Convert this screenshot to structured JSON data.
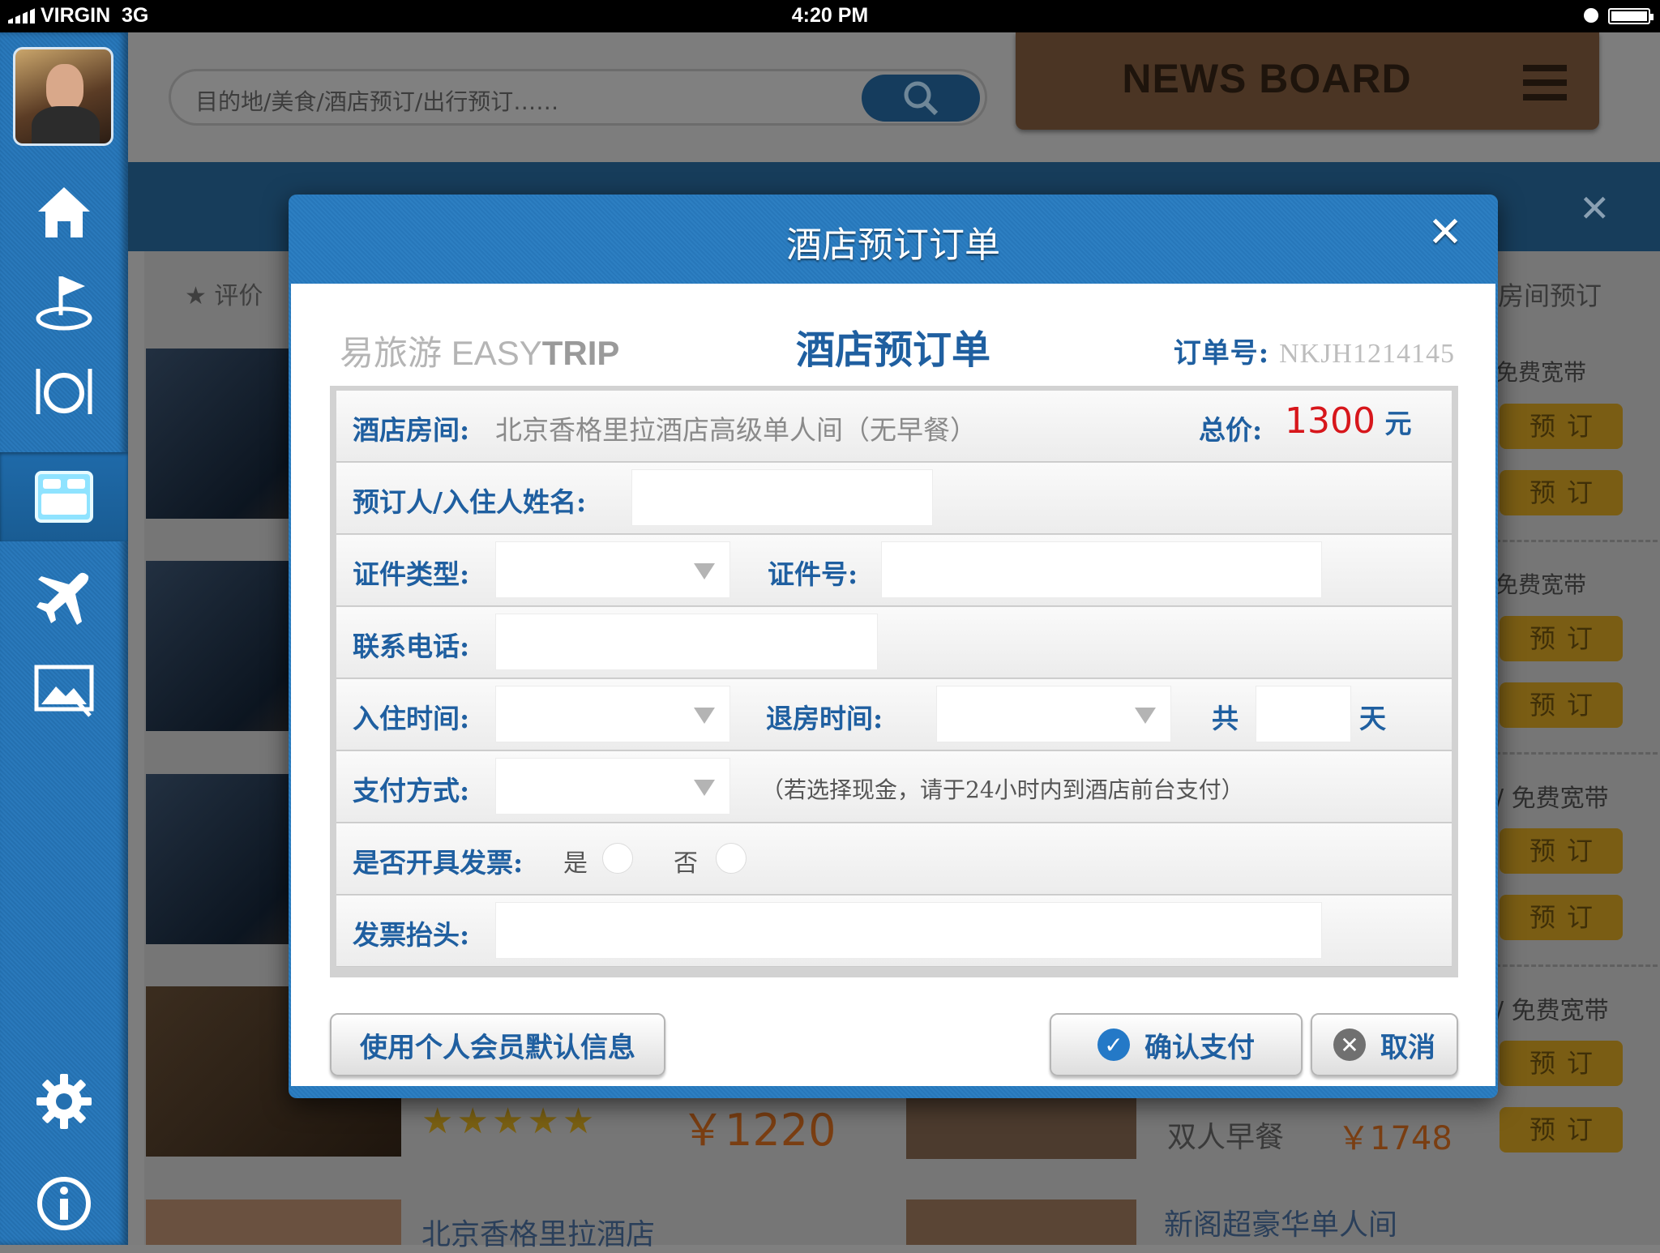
{
  "status": {
    "carrier": "VIRGIN",
    "network": "3G",
    "time": "4:20 PM"
  },
  "sidebar": {
    "items": [
      {
        "name": "home",
        "icon": "home-icon"
      },
      {
        "name": "attractions",
        "icon": "flag-icon"
      },
      {
        "name": "food",
        "icon": "dining-icon"
      },
      {
        "name": "hotel",
        "icon": "bed-icon",
        "active": true
      },
      {
        "name": "flight",
        "icon": "airplane-icon"
      },
      {
        "name": "photos",
        "icon": "photo-icon"
      },
      {
        "name": "settings",
        "icon": "gear-icon"
      },
      {
        "name": "info",
        "icon": "info-icon"
      }
    ]
  },
  "search": {
    "placeholder": "目的地/美食/酒店预订/出行预订……"
  },
  "news_board": {
    "title": "NEWS BOARD"
  },
  "background": {
    "filter_label": "★ 评价",
    "room_booking_label": "房间预订",
    "broadband_labels": [
      "免费宽带",
      "免费宽带",
      "/ 免费宽带",
      "/ 免费宽带"
    ],
    "book_label": "预订",
    "stars": "★★★★★",
    "price1": "￥1220",
    "breakfast": "双人早餐",
    "price2": "￥1748",
    "hotel_name_partial": "北京香格里拉酒店",
    "room_name_partial": "新阁超豪华单人间"
  },
  "modal": {
    "title": "酒店预订订单",
    "brand_prefix": "易旅游",
    "brand_easy": "EASY",
    "brand_trip": "TRIP",
    "form_title": "酒店预订单",
    "order_label": "订单号:",
    "order_number": "NKJH1214145",
    "room_label": "酒店房间:",
    "room_value": "北京香格里拉酒店高级单人间（无早餐）",
    "total_label": "总价:",
    "total_value": "1300",
    "currency": "元",
    "guest_name_label": "预订人/入住人姓名:",
    "id_type_label": "证件类型:",
    "id_number_label": "证件号:",
    "phone_label": "联系电话:",
    "checkin_label": "入住时间:",
    "checkout_label": "退房时间:",
    "total_days_prefix": "共",
    "total_days_suffix": "天",
    "payment_label": "支付方式:",
    "payment_note": "（若选择现金，请于24小时内到酒店前台支付）",
    "invoice_label": "是否开具发票:",
    "invoice_yes": "是",
    "invoice_no": "否",
    "invoice_title_label": "发票抬头:",
    "use_member_info_button": "使用个人会员默认信息",
    "confirm_button": "确认支付",
    "cancel_button": "取消"
  },
  "colors": {
    "accent": "#1f5fa0",
    "price": "#d7161b",
    "modal_blue": "#2d7fc2"
  }
}
